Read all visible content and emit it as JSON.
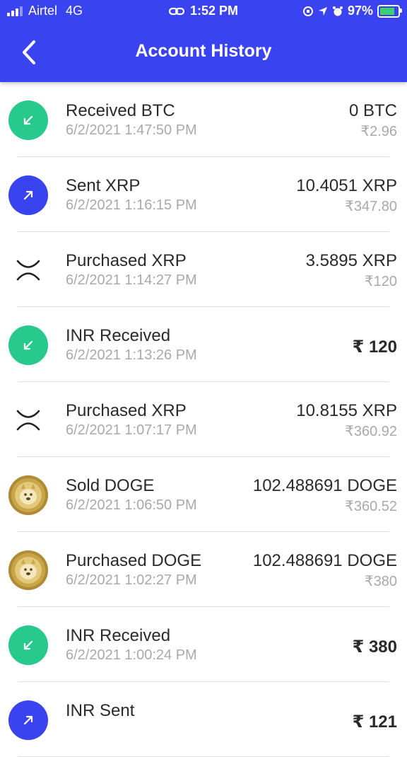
{
  "status_bar": {
    "carrier": "Airtel",
    "network": "4G",
    "time": "1:52 PM",
    "battery": "97%",
    "battery_color": "#3bd16f"
  },
  "header": {
    "title": "Account History",
    "back_icon": "chevron-left-icon",
    "color": "#3a43f0"
  },
  "transactions": [
    {
      "type": "received",
      "icon": "arrow-down-left-icon",
      "title": "Received BTC",
      "date": "6/2/2021 1:47:50 PM",
      "amount": "0 BTC",
      "fiat": "₹2.96"
    },
    {
      "type": "sent",
      "icon": "arrow-up-right-icon",
      "title": "Sent XRP",
      "date": "6/2/2021 1:16:15 PM",
      "amount": "10.4051 XRP",
      "fiat": "₹347.80"
    },
    {
      "type": "xrp",
      "icon": "xrp-icon",
      "title": "Purchased XRP",
      "date": "6/2/2021 1:14:27 PM",
      "amount": "3.5895 XRP",
      "fiat": "₹120"
    },
    {
      "type": "received",
      "icon": "arrow-down-left-icon",
      "title": "INR Received",
      "date": "6/2/2021 1:13:26 PM",
      "amount": "₹ 120",
      "fiat": ""
    },
    {
      "type": "xrp",
      "icon": "xrp-icon",
      "title": "Purchased XRP",
      "date": "6/2/2021 1:07:17 PM",
      "amount": "10.8155 XRP",
      "fiat": "₹360.92"
    },
    {
      "type": "doge",
      "icon": "doge-icon",
      "title": "Sold DOGE",
      "date": "6/2/2021 1:06:50 PM",
      "amount": "102.488691 DOGE",
      "fiat": "₹360.52"
    },
    {
      "type": "doge",
      "icon": "doge-icon",
      "title": "Purchased DOGE",
      "date": "6/2/2021 1:02:27 PM",
      "amount": "102.488691 DOGE",
      "fiat": "₹380"
    },
    {
      "type": "received",
      "icon": "arrow-down-left-icon",
      "title": "INR Received",
      "date": "6/2/2021 1:00:24 PM",
      "amount": "₹ 380",
      "fiat": ""
    },
    {
      "type": "sent",
      "icon": "arrow-up-right-icon",
      "title": "INR Sent",
      "date": "",
      "amount": "₹ 121",
      "fiat": ""
    }
  ],
  "colors": {
    "received": "#27c98d",
    "sent": "#3a43f0",
    "doge": "#c9a54a",
    "primary_text": "#2a2a2a",
    "secondary_text": "#a9a9a9"
  }
}
